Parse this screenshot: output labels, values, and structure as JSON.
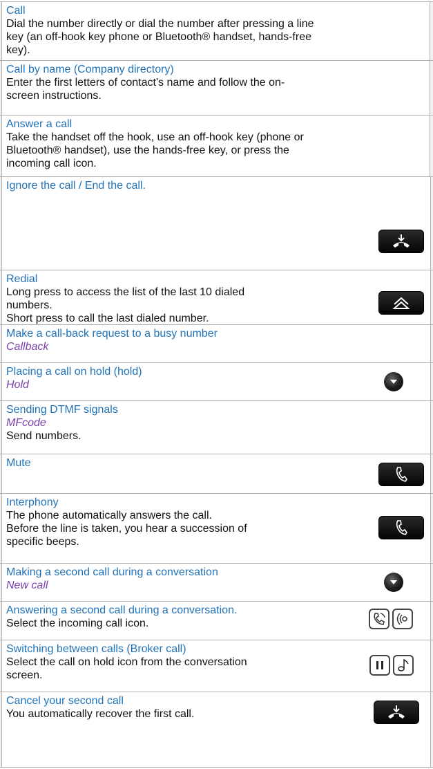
{
  "rows": [
    {
      "title": "Call",
      "lines": [
        "Dial the number directly or dial the number after pressing a line",
        "key (an off-hook key phone or Bluetooth® handset, hands-free",
        "key)."
      ]
    },
    {
      "title": "Call by name (Company directory)",
      "lines": [
        "Enter the first letters of contact's name and follow the on-",
        "screen instructions."
      ]
    },
    {
      "title": "Answer a call",
      "lines": [
        "Take the handset off the hook, use an off-hook key (phone or",
        "Bluetooth® handset), use the hands-free key, or press the",
        "incoming call icon."
      ]
    },
    {
      "title": "Ignore the call / End the call.",
      "icon": "hang-up-key-icon"
    },
    {
      "title": "Redial",
      "lines": [
        "Long press to access the list of the last 10 dialed",
        "numbers.",
        "Short press to call the last dialed number."
      ],
      "icon": "redial-key-icon"
    },
    {
      "title": "Make a call-back request to a busy number",
      "command": "Callback"
    },
    {
      "title": "Placing a call on hold (hold)",
      "command": "Hold",
      "icon": "navigator-key-icon"
    },
    {
      "title": "Sending DTMF signals",
      "command": "MFcode",
      "lines": [
        "Send numbers."
      ]
    },
    {
      "title": "Mute",
      "icon": "mute-key-icon"
    },
    {
      "title": "Interphony",
      "lines": [
        "The phone automatically answers the call.",
        "Before the line is taken, you hear a succession of",
        "specific beeps."
      ],
      "icon": "interphony-key-icon"
    },
    {
      "title": "Making a second call during a conversation",
      "command": "New call",
      "icon": "navigator-key-icon"
    },
    {
      "title": "Answering a second call during a conversation.",
      "lines": [
        "Select the incoming call icon."
      ],
      "icon": "incoming-call-icons"
    },
    {
      "title": "Switching between calls (Broker call)",
      "lines": [
        "Select the call on hold icon from the conversation",
        "screen."
      ],
      "icon": "hold-call-icons"
    },
    {
      "title": "Cancel your second call",
      "lines": [
        "You automatically recover the first call."
      ],
      "icon": "hang-up-key-icon"
    }
  ]
}
